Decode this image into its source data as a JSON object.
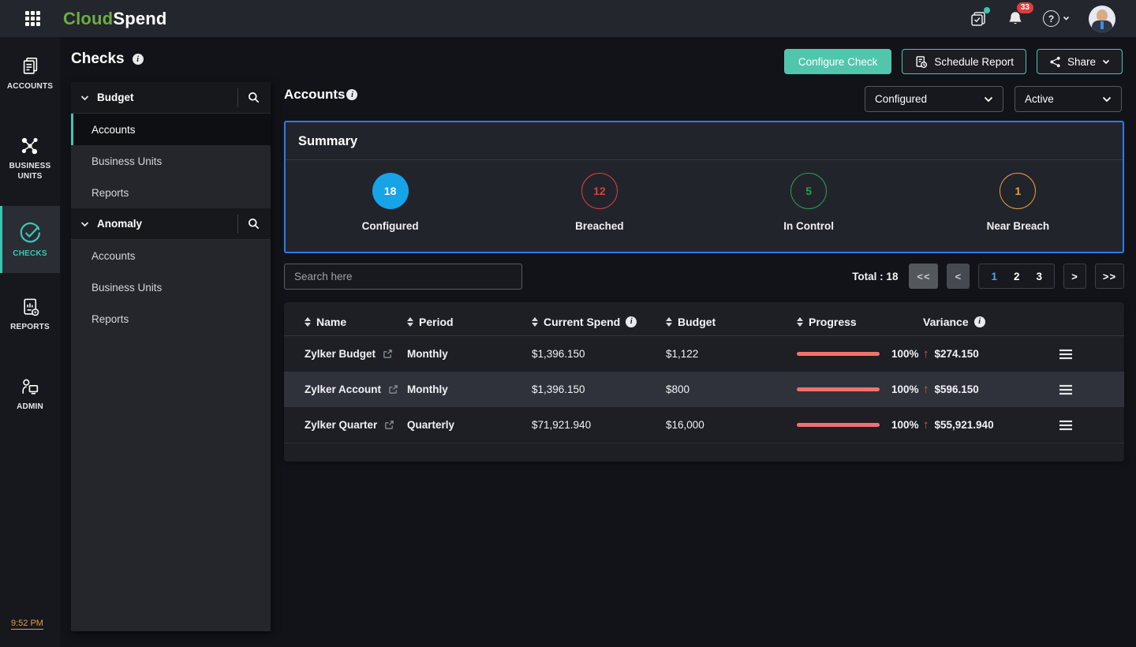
{
  "colors": {
    "accent_teal": "#4cc3ae",
    "summary_border": "#2e7bea",
    "progress_red": "#f3716d",
    "active_page_blue": "#4aa3f0"
  },
  "topbar": {
    "logo_cloud": "Cloud",
    "logo_spend": "Spend",
    "notification_count": "33",
    "help_glyph": "?"
  },
  "rail": {
    "items": [
      {
        "label": "ACCOUNTS"
      },
      {
        "label": "BUSINESS UNITS"
      },
      {
        "label": "CHECKS"
      },
      {
        "label": "REPORTS"
      },
      {
        "label": "ADMIN"
      }
    ],
    "time": "9:52 PM"
  },
  "sidebar": {
    "title": "Checks",
    "sections": [
      {
        "label": "Budget",
        "items": [
          "Accounts",
          "Business Units",
          "Reports"
        ]
      },
      {
        "label": "Anomaly",
        "items": [
          "Accounts",
          "Business Units",
          "Reports"
        ]
      }
    ]
  },
  "actions": {
    "configure_check": "Configure Check",
    "schedule_report": "Schedule Report",
    "share": "Share"
  },
  "main": {
    "title": "Accounts",
    "filter_configured": "Configured",
    "filter_active": "Active",
    "summary": {
      "title": "Summary",
      "stats": [
        {
          "value": "18",
          "label": "Configured",
          "color": "#17a3e8",
          "filled": true
        },
        {
          "value": "12",
          "label": "Breached",
          "color": "#d8423c",
          "filled": false
        },
        {
          "value": "5",
          "label": "In Control",
          "color": "#2aa14c",
          "filled": false
        },
        {
          "value": "1",
          "label": "Near Breach",
          "color": "#e3a23b",
          "filled": false
        }
      ]
    },
    "search_placeholder": "Search here",
    "pagination": {
      "total": "Total : 18",
      "first": "<<",
      "prev": "<",
      "pages": [
        "1",
        "2",
        "3"
      ],
      "active_page": "1",
      "next": ">",
      "last": ">>"
    },
    "table": {
      "columns": [
        {
          "label": "Name"
        },
        {
          "label": "Period"
        },
        {
          "label": "Current Spend"
        },
        {
          "label": "Budget"
        },
        {
          "label": "Progress"
        },
        {
          "label": "Variance"
        }
      ],
      "rows": [
        {
          "name": "Zylker Budget",
          "period": "Monthly",
          "current_spend": "$1,396.150",
          "budget": "$1,122",
          "progress_pct": "100%",
          "variance": "$274.150"
        },
        {
          "name": "Zylker Account",
          "period": "Monthly",
          "current_spend": "$1,396.150",
          "budget": "$800",
          "progress_pct": "100%",
          "variance": "$596.150"
        },
        {
          "name": "Zylker Quarter",
          "period": "Quarterly",
          "current_spend": "$71,921.940",
          "budget": "$16,000",
          "progress_pct": "100%",
          "variance": "$55,921.940"
        }
      ]
    }
  }
}
